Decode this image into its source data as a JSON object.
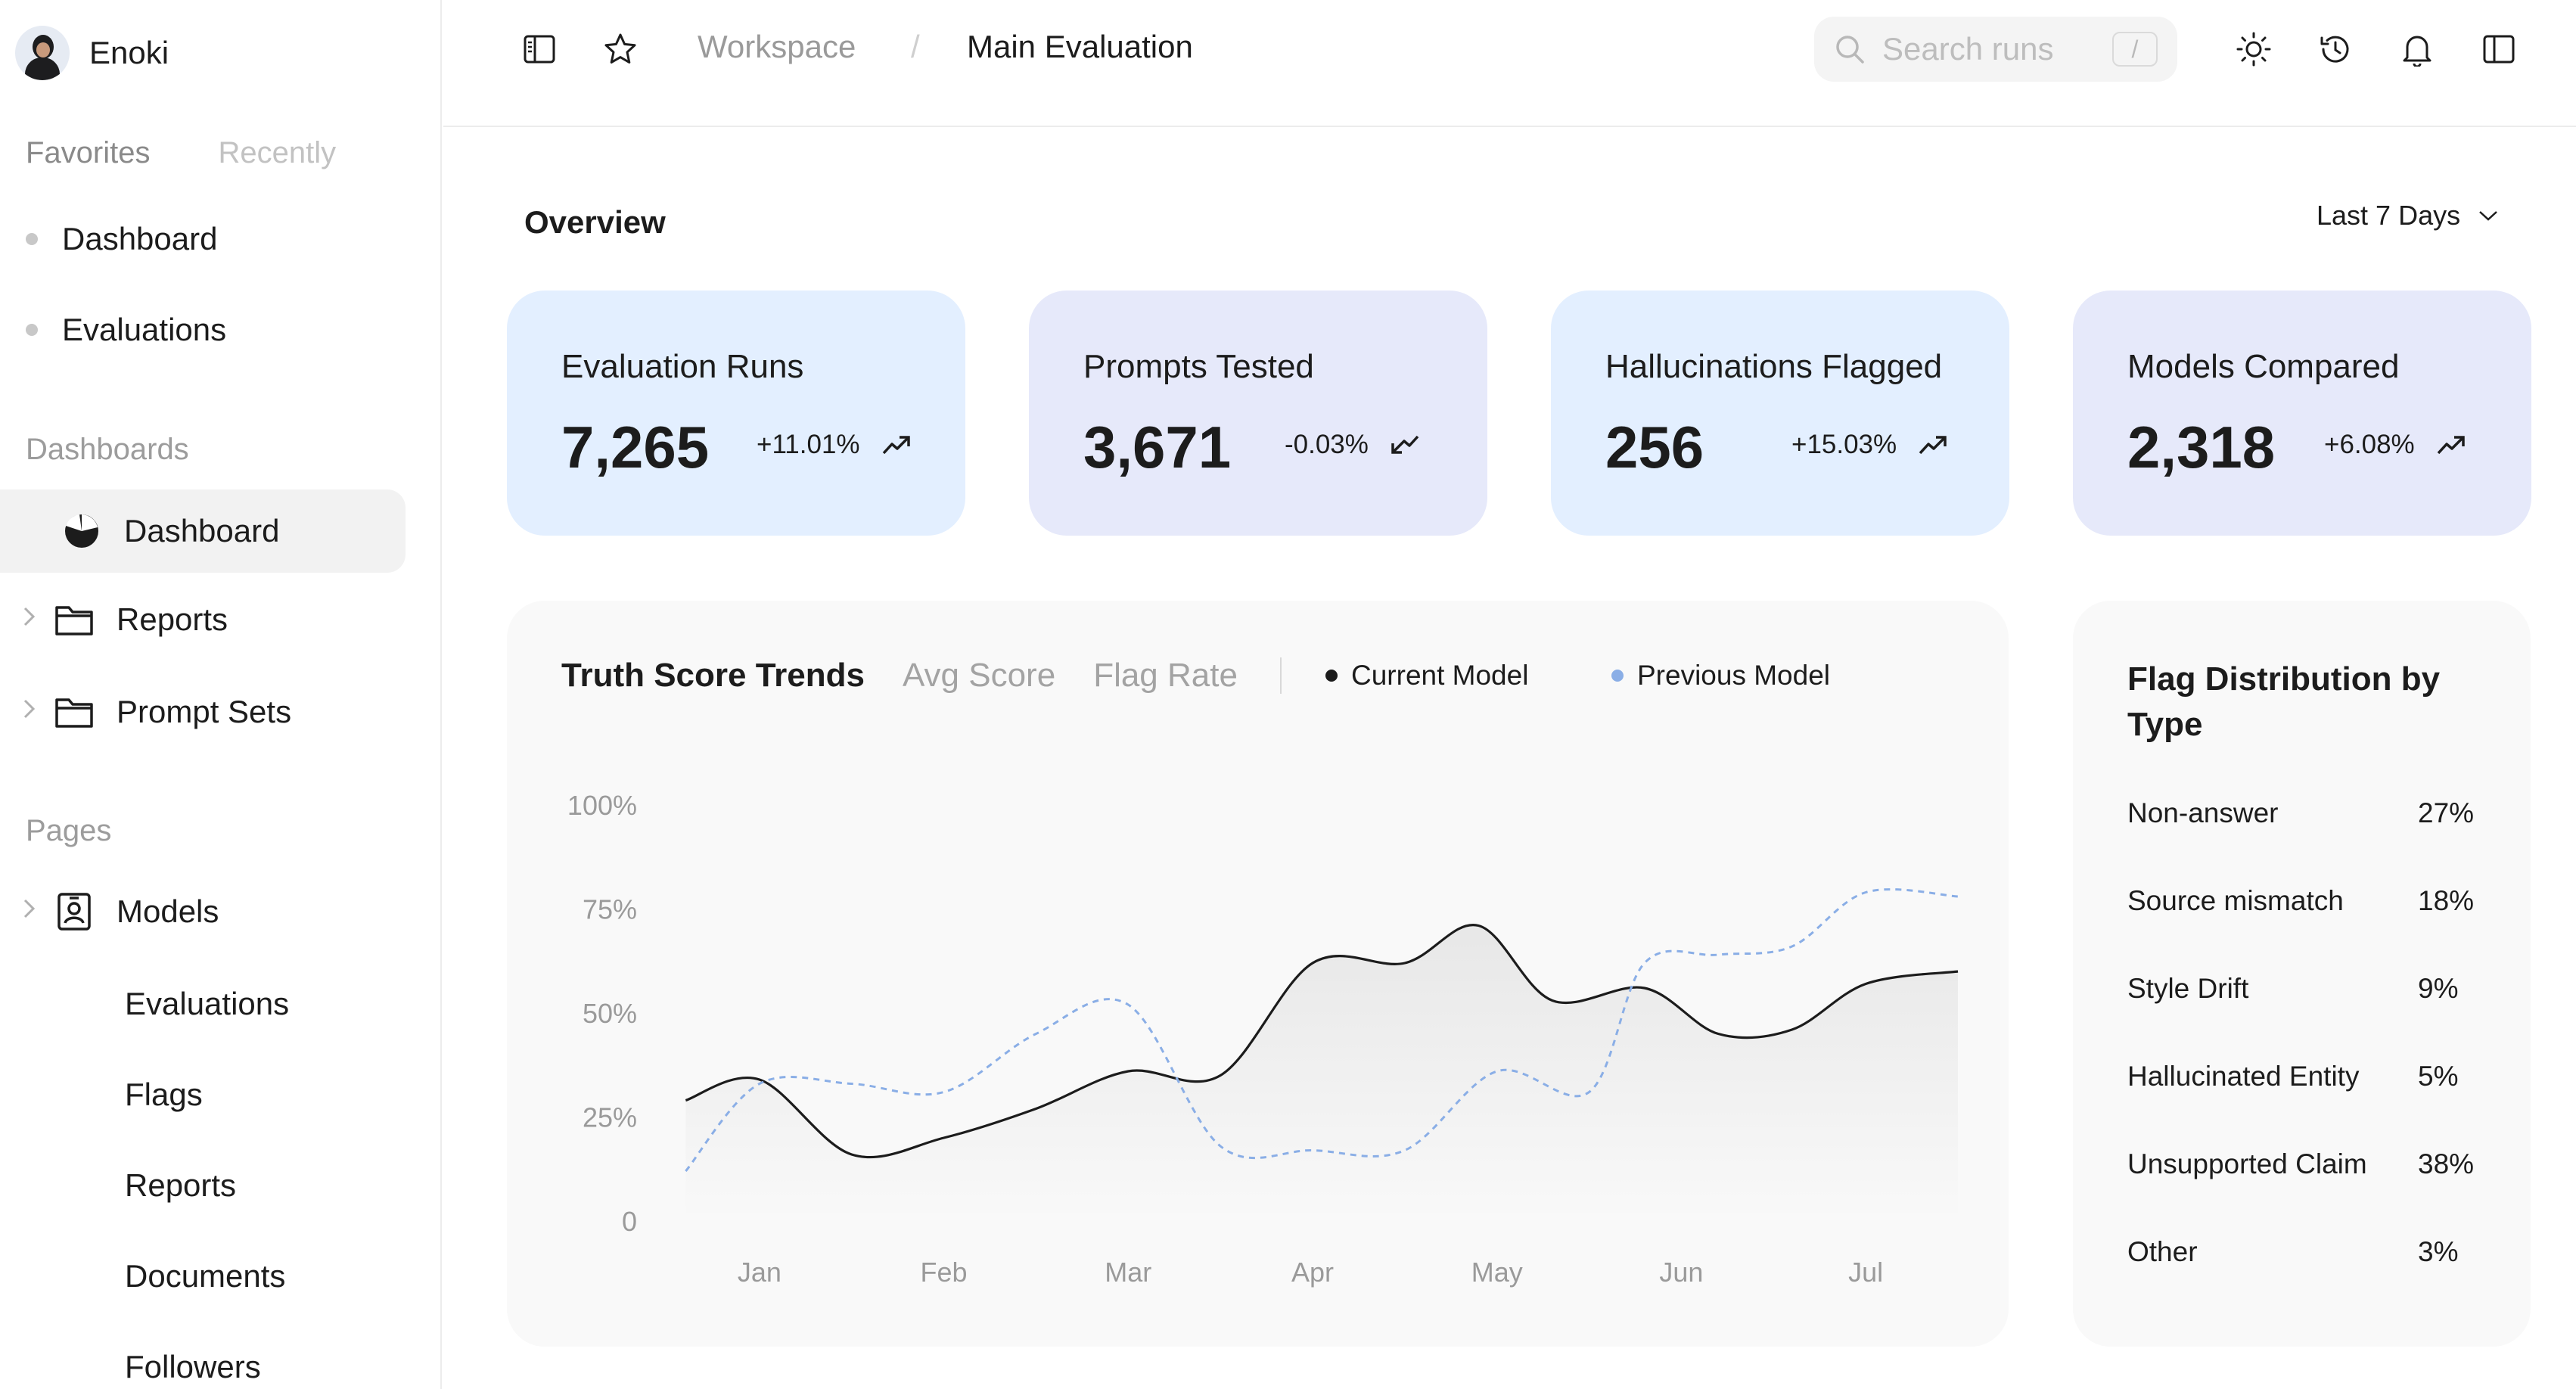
{
  "sidebar": {
    "user_name": "Enoki",
    "tabs": {
      "favorites": "Favorites",
      "recently": "Recently"
    },
    "favorites": [
      "Dashboard",
      "Evaluations"
    ],
    "dashboards_label": "Dashboards",
    "dashboards": [
      {
        "label": "Dashboard",
        "icon": "pie-chart-icon",
        "active": true
      },
      {
        "label": "Reports",
        "icon": "folder-icon",
        "expandable": true
      },
      {
        "label": "Prompt Sets",
        "icon": "folder-icon",
        "expandable": true
      }
    ],
    "pages_label": "Pages",
    "pages": {
      "models": {
        "label": "Models",
        "icon": "id-badge-icon",
        "expandable": true
      },
      "sub_items": [
        "Evaluations",
        "Flags",
        "Reports",
        "Documents",
        "Followers"
      ]
    }
  },
  "topbar": {
    "breadcrumb": [
      "Workspace",
      "/",
      "Main Evaluation"
    ],
    "search_placeholder": "Search runs",
    "search_shortcut": "/"
  },
  "overview": {
    "title": "Overview",
    "range": "Last 7 Days",
    "cards": [
      {
        "label": "Evaluation Runs",
        "value": "7,265",
        "delta": "+11.01%",
        "trend": "up",
        "color": "#e3efff"
      },
      {
        "label": "Prompts Tested",
        "value": "3,671",
        "delta": "-0.03%",
        "trend": "down",
        "color": "#e6e9fa"
      },
      {
        "label": "Hallucinations Flagged",
        "value": "256",
        "delta": "+15.03%",
        "trend": "up",
        "color": "#e3efff"
      },
      {
        "label": "Models Compared",
        "value": "2,318",
        "delta": "+6.08%",
        "trend": "up",
        "color": "#e6e9fa"
      }
    ]
  },
  "trend_chart": {
    "tabs": {
      "active": "Truth Score Trends",
      "avg": "Avg Score",
      "flag": "Flag Rate"
    },
    "legend": {
      "current": "Current Model",
      "previous": "Previous Model"
    },
    "colors": {
      "current": "#1c1c1c",
      "previous": "#8aaee6"
    }
  },
  "chart_data": {
    "type": "line",
    "title": "Truth Score Trends",
    "categories": [
      "Jan",
      "Feb",
      "Mar",
      "Apr",
      "May",
      "Jun",
      "Jul"
    ],
    "y_ticks": [
      "0",
      "25%",
      "50%",
      "75%",
      "100%"
    ],
    "y_tick_values": [
      0,
      25,
      50,
      75,
      100
    ],
    "ylim": [
      0,
      100
    ],
    "xlim": [
      0.5,
      7.5
    ],
    "grid": false,
    "legend_position": "top",
    "series": [
      {
        "name": "Current Model",
        "style": "solid",
        "fill": true,
        "x": [
          0.6,
          1.0,
          1.5,
          2.0,
          2.5,
          3.0,
          3.5,
          4.0,
          4.5,
          4.9,
          5.3,
          5.8,
          6.2,
          6.6,
          7.0,
          7.5
        ],
        "y": [
          29,
          34,
          16,
          20,
          27,
          36,
          35,
          62,
          62,
          71,
          53,
          56,
          45,
          46,
          57,
          60
        ]
      },
      {
        "name": "Previous Model",
        "style": "dashed",
        "fill": false,
        "x": [
          0.6,
          1.0,
          1.5,
          2.0,
          2.5,
          3.0,
          3.5,
          4.0,
          4.5,
          5.0,
          5.5,
          5.8,
          6.2,
          6.6,
          7.0,
          7.5
        ],
        "y": [
          12,
          33,
          33,
          31,
          45,
          52,
          18,
          17,
          17,
          36,
          31,
          62,
          64,
          66,
          79,
          78
        ]
      }
    ]
  },
  "flag_distribution": {
    "title": "Flag Distribution by Type",
    "rows": [
      {
        "label": "Non-answer",
        "value": "27%"
      },
      {
        "label": "Source mismatch",
        "value": "18%"
      },
      {
        "label": "Style Drift",
        "value": "9%"
      },
      {
        "label": "Hallucinated Entity",
        "value": "5%"
      },
      {
        "label": "Unsupported Claim",
        "value": "38%"
      },
      {
        "label": "Other",
        "value": "3%"
      }
    ]
  }
}
